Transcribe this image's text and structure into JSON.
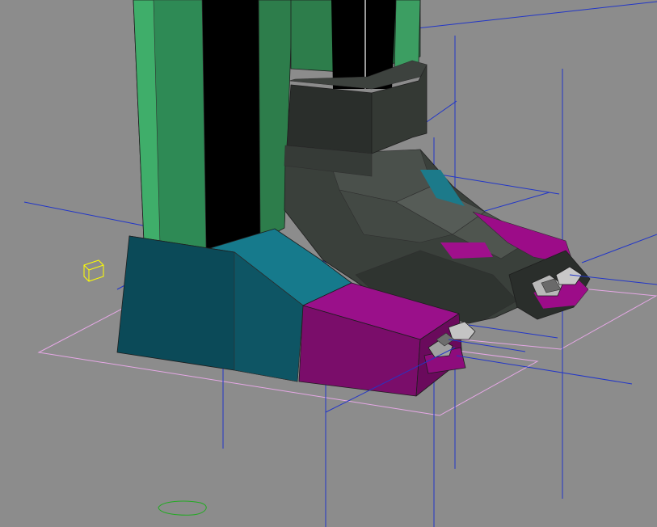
{
  "viewport": {
    "background_color": "#8c8c8c",
    "helper_line_color": "#2236c8",
    "ground_grid_color": "#e6a8e6",
    "light_helper_color": "#ffff00",
    "spline_color": "#22aa22"
  },
  "objects": {
    "leg": {
      "color_light": "#3fae6a",
      "color_dark": "#2d7d4b",
      "inner": "#000000"
    },
    "ankle_band": {
      "color": "#2a2e2b"
    },
    "left_sole": {
      "color_top": "#167a8c",
      "color_side": "#0b4a58"
    },
    "left_toe": {
      "color": "#8e0c7c"
    },
    "right_boot": {
      "color": "#3a403b"
    },
    "right_toe": {
      "color": "#9c0c88"
    },
    "claws": {
      "color": "#8a8a8a"
    }
  }
}
